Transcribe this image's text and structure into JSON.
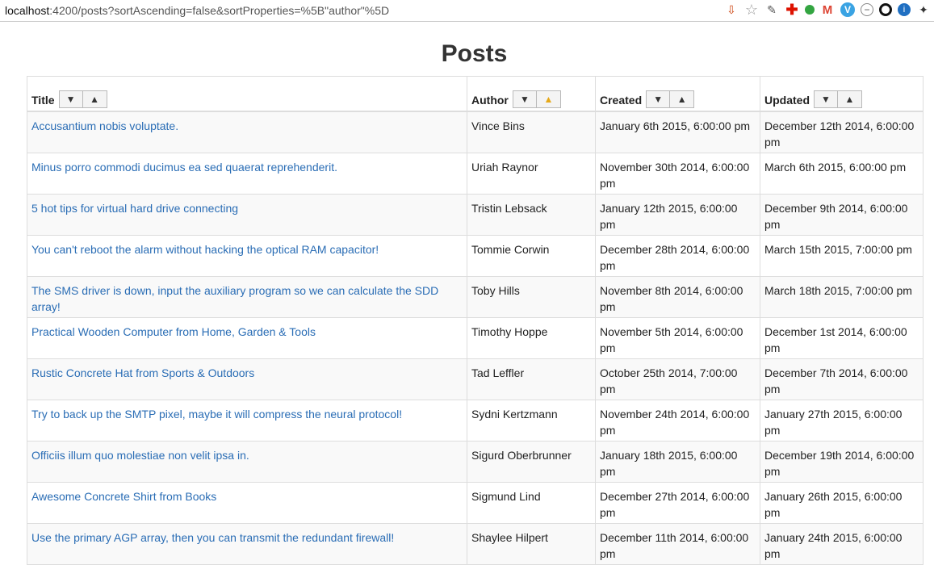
{
  "browser": {
    "url_host": "localhost",
    "url_rest": ":4200/posts?sortAscending=false&sortProperties=%5B\"author\"%5D",
    "extensions": [
      "save-icon",
      "star-icon",
      "eyedropper-icon",
      "plus-cross-icon",
      "green-dot-icon",
      "gmail-icon",
      "v-icon",
      "minus-circle-icon",
      "ring-icon",
      "info-icon",
      "more-icon"
    ]
  },
  "page": {
    "title": "Posts"
  },
  "table": {
    "columns": [
      {
        "key": "title",
        "label": "Title",
        "sort_desc": "▼",
        "sort_asc": "▲"
      },
      {
        "key": "author",
        "label": "Author",
        "sort_desc": "▼",
        "sort_asc": "▲"
      },
      {
        "key": "created",
        "label": "Created",
        "sort_desc": "▼",
        "sort_asc": "▲"
      },
      {
        "key": "updated",
        "label": "Updated",
        "sort_desc": "▼",
        "sort_asc": "▲"
      }
    ],
    "active_sort": {
      "column": "author",
      "direction": "asc",
      "highlight_color": "#e6a817"
    },
    "rows": [
      {
        "title": "Accusantium nobis voluptate.",
        "author": "Vince Bins",
        "created": "January 6th 2015, 6:00:00 pm",
        "updated": "December 12th 2014, 6:00:00 pm"
      },
      {
        "title": "Minus porro commodi ducimus ea sed quaerat reprehenderit.",
        "author": "Uriah Raynor",
        "created": "November 30th 2014, 6:00:00 pm",
        "updated": "March 6th 2015, 6:00:00 pm"
      },
      {
        "title": "5 hot tips for virtual hard drive connecting",
        "author": "Tristin Lebsack",
        "created": "January 12th 2015, 6:00:00 pm",
        "updated": "December 9th 2014, 6:00:00 pm"
      },
      {
        "title": "You can't reboot the alarm without hacking the optical RAM capacitor!",
        "author": "Tommie Corwin",
        "created": "December 28th 2014, 6:00:00 pm",
        "updated": "March 15th 2015, 7:00:00 pm"
      },
      {
        "title": "The SMS driver is down, input the auxiliary program so we can calculate the SDD array!",
        "author": "Toby Hills",
        "created": "November 8th 2014, 6:00:00 pm",
        "updated": "March 18th 2015, 7:00:00 pm"
      },
      {
        "title": "Practical Wooden Computer from Home, Garden & Tools",
        "author": "Timothy Hoppe",
        "created": "November 5th 2014, 6:00:00 pm",
        "updated": "December 1st 2014, 6:00:00 pm"
      },
      {
        "title": "Rustic Concrete Hat from Sports & Outdoors",
        "author": "Tad Leffler",
        "created": "October 25th 2014, 7:00:00 pm",
        "updated": "December 7th 2014, 6:00:00 pm"
      },
      {
        "title": "Try to back up the SMTP pixel, maybe it will compress the neural protocol!",
        "author": "Sydni Kertzmann",
        "created": "November 24th 2014, 6:00:00 pm",
        "updated": "January 27th 2015, 6:00:00 pm"
      },
      {
        "title": "Officiis illum quo molestiae non velit ipsa in.",
        "author": "Sigurd Oberbrunner",
        "created": "January 18th 2015, 6:00:00 pm",
        "updated": "December 19th 2014, 6:00:00 pm"
      },
      {
        "title": "Awesome Concrete Shirt from Books",
        "author": "Sigmund Lind",
        "created": "December 27th 2014, 6:00:00 pm",
        "updated": "January 26th 2015, 6:00:00 pm"
      },
      {
        "title": "Use the primary AGP array, then you can transmit the redundant firewall!",
        "author": "Shaylee Hilpert",
        "created": "December 11th 2014, 6:00:00 pm",
        "updated": "January 24th 2015, 6:00:00 pm"
      }
    ]
  }
}
